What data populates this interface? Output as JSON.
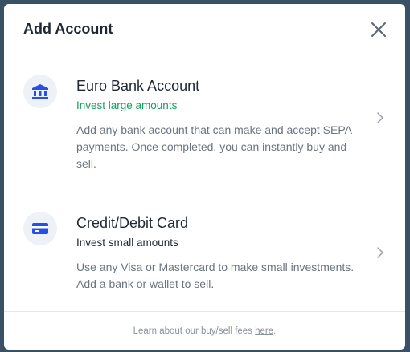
{
  "dialog": {
    "title": "Add Account"
  },
  "options": [
    {
      "icon": "bank-icon",
      "title": "Euro Bank Account",
      "subtitle": "Invest large amounts",
      "description": "Add any bank account that can make and accept SEPA payments. Once completed, you can instantly buy and sell."
    },
    {
      "icon": "credit-card-icon",
      "title": "Credit/Debit Card",
      "subtitle": "Invest small amounts",
      "description": "Use any Visa or Mastercard to make small investments. Add a bank or wallet to sell."
    }
  ],
  "footer": {
    "text": "Learn about our buy/sell fees ",
    "link": "here",
    "suffix": "."
  },
  "colors": {
    "accent_blue": "#2450e8",
    "green": "#12a05c"
  }
}
